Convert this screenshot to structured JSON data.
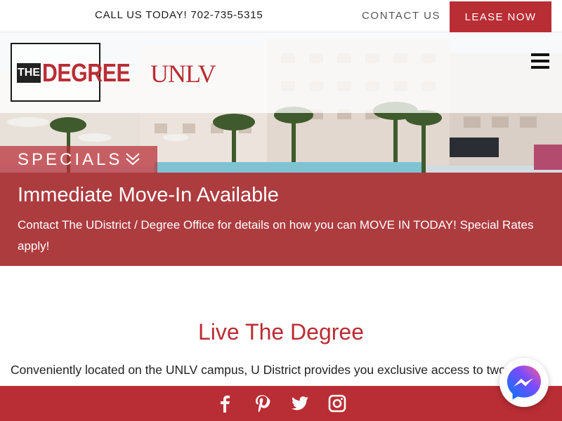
{
  "topbar": {
    "phone_text": "CALL US TODAY! 702-735-5315",
    "contact_label": "CONTACT US",
    "lease_label": "LEASE NOW"
  },
  "brand": {
    "logo_the": "THE",
    "logo_degree": "DEGREE",
    "partner_logo": "UNLV",
    "accent_color": "#b92d34"
  },
  "specials": {
    "tab_label": "SPECIALS",
    "title": "Immediate Move-In Available",
    "description": "Contact The UDistrict / Degree Office for details on how you can MOVE IN TODAY!  Special Rates apply!"
  },
  "main": {
    "section_title": "Live The Degree",
    "intro_text": "Conveniently located on the UNLV campus, U District provides you exclusive access to two living"
  },
  "social": {
    "icons": [
      "facebook-icon",
      "pinterest-icon",
      "twitter-icon",
      "instagram-icon"
    ]
  },
  "chat": {
    "icon": "messenger-icon"
  }
}
